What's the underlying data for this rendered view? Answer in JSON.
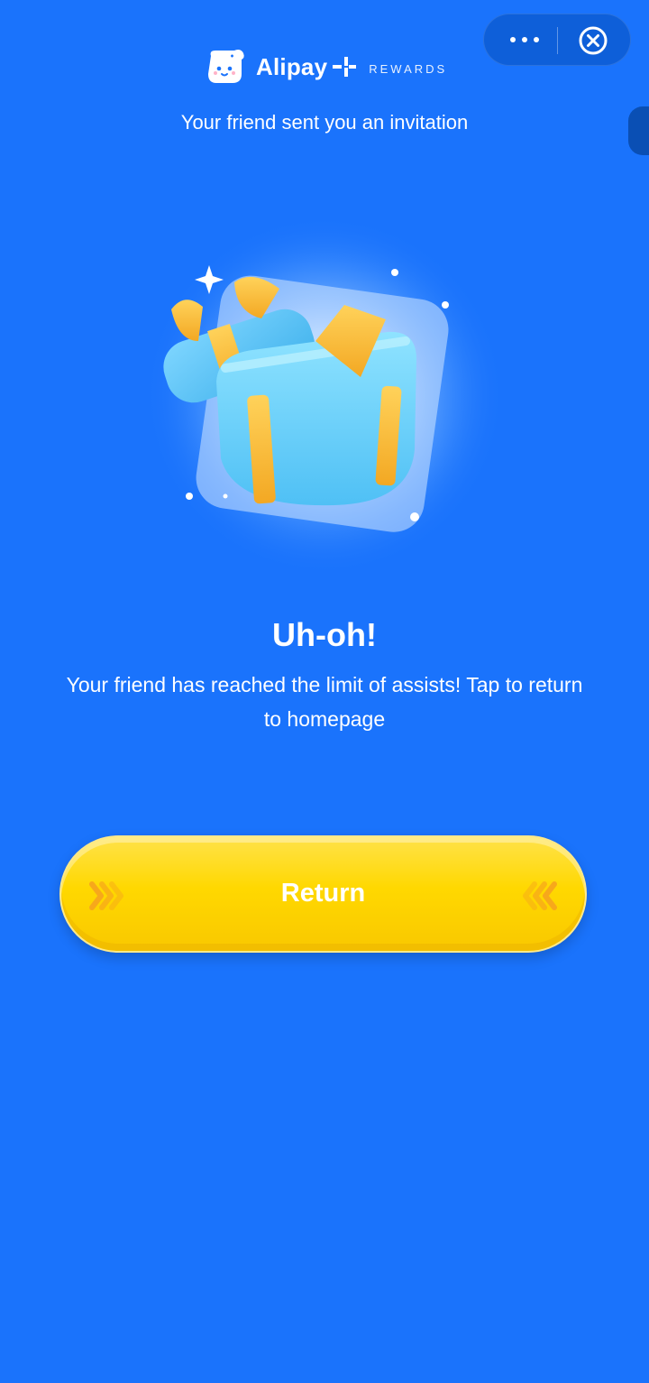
{
  "brand": {
    "name": "Alipay",
    "sub": "REWARDS",
    "mascot_icon": "mascot-icon",
    "plus_icon": "alipay-plus-icon"
  },
  "header": {
    "invite_text": "Your friend sent you an invitation"
  },
  "capsule": {
    "more_icon": "more-dots-icon",
    "close_icon": "close-circle-icon"
  },
  "illustration": {
    "icon": "open-gift-box-icon"
  },
  "main": {
    "title": "Uh-oh!",
    "message": "Your friend has reached the limit of assists! Tap to return to homepage"
  },
  "button": {
    "label": "Return",
    "left_icon": "chevrons-right-icon",
    "right_icon": "chevrons-left-icon"
  },
  "colors": {
    "background": "#1a73fc",
    "button": "#ffd800",
    "button_text": "#ffffff",
    "chevron": "#f7a51c"
  }
}
